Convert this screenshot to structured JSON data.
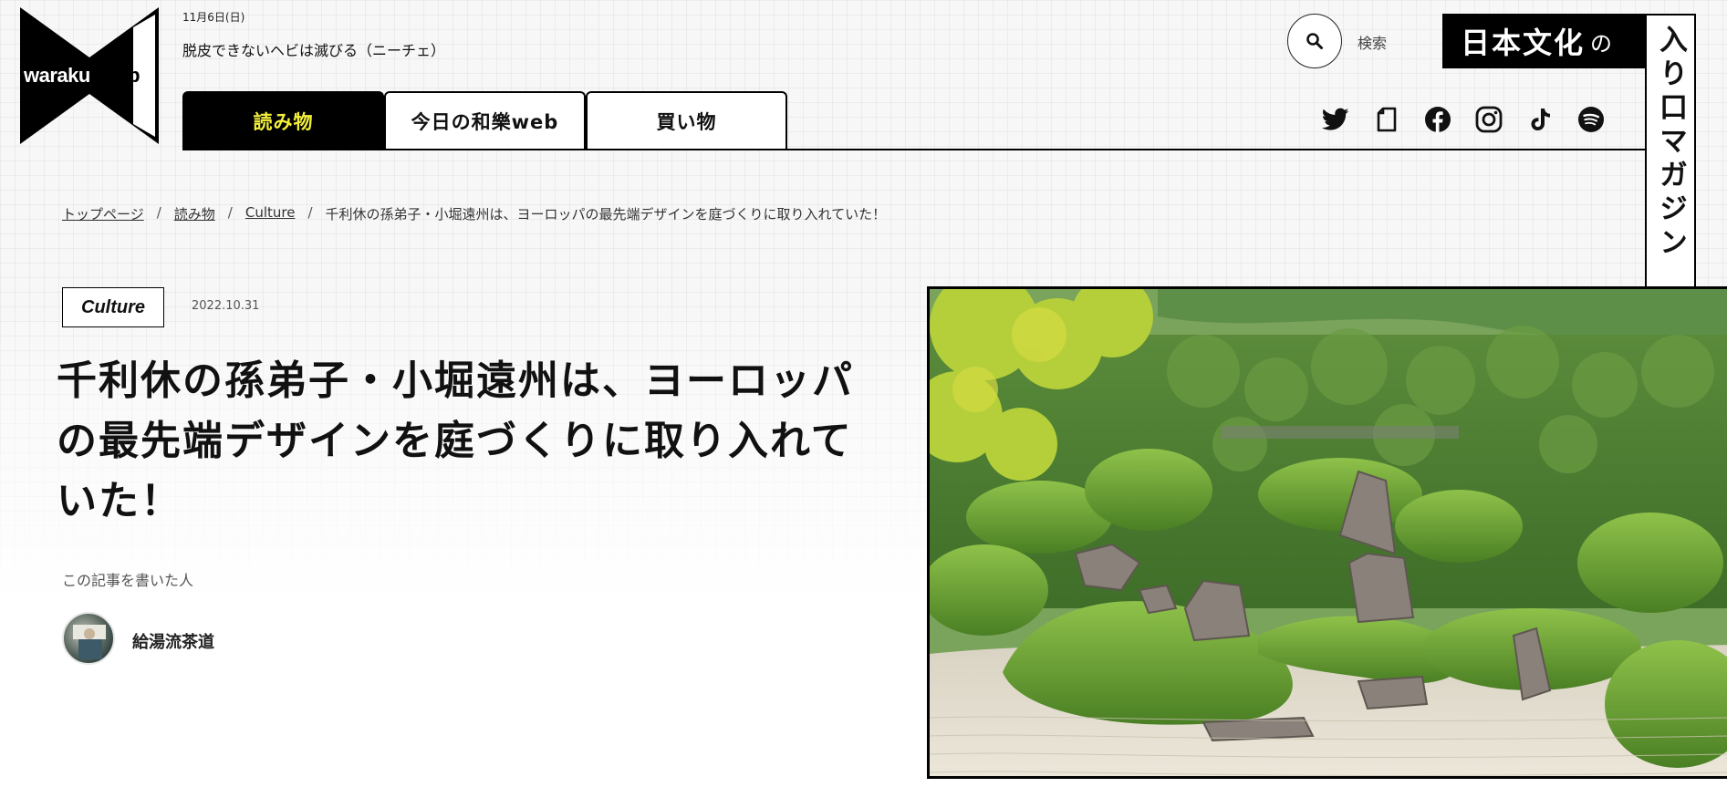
{
  "logo": {
    "part1": "waraku",
    "part2": "uweb"
  },
  "header": {
    "date": "11月6日(日)",
    "quote": "脱皮できないヘビは滅びる（ニーチェ）",
    "search_label": "検索",
    "tagline_horizontal": "日本文化",
    "tagline_particle": "の",
    "tagline_vertical": "入り口マガジン"
  },
  "tabs": [
    {
      "label": "読み物",
      "active": true
    },
    {
      "label": "今日の和樂web",
      "active": false
    },
    {
      "label": "買い物",
      "active": false
    }
  ],
  "social_icons": [
    "twitter-icon",
    "note-icon",
    "facebook-icon",
    "instagram-icon",
    "tiktok-icon",
    "spotify-icon"
  ],
  "breadcrumb": {
    "items": [
      "トップページ",
      "読み物",
      "Culture"
    ],
    "current": "千利休の孫弟子・小堀遠州は、ヨーロッパの最先端デザインを庭づくりに取り入れていた！",
    "separator": "/"
  },
  "article": {
    "category": "Culture",
    "date": "2022.10.31",
    "title": "千利休の孫弟子・小堀遠州は、ヨーロッパの最先端デザインを庭づくりに取り入れていた！",
    "byline_label": "この記事を書いた人",
    "author": "給湯流茶道"
  },
  "colors": {
    "accent_yellow": "#f2ef3a",
    "black": "#000000"
  }
}
